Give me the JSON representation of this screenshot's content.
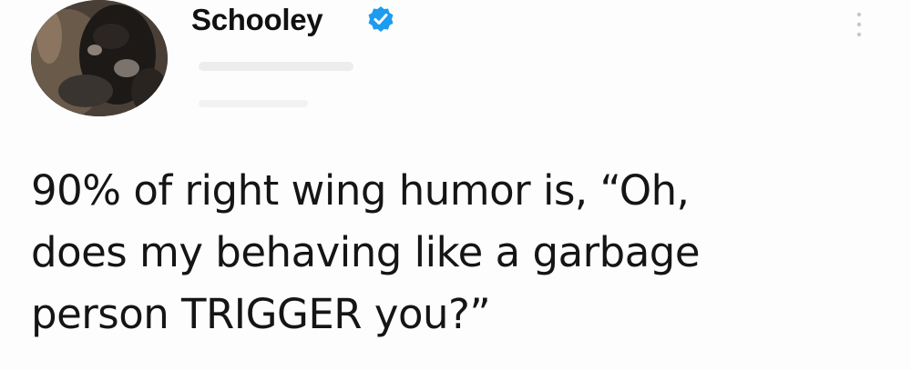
{
  "author": {
    "display_name": "Schooley",
    "verified": true,
    "verified_icon": "verified-badge-icon",
    "avatar": "dog-avatar",
    "badge_color": "#1d9bf0"
  },
  "tweet": {
    "lines": [
      "90% of right wing humor is, “Oh,",
      "does my behaving like a garbage",
      "person TRIGGER you?”"
    ]
  },
  "menu": {
    "icon": "more-options-icon"
  }
}
